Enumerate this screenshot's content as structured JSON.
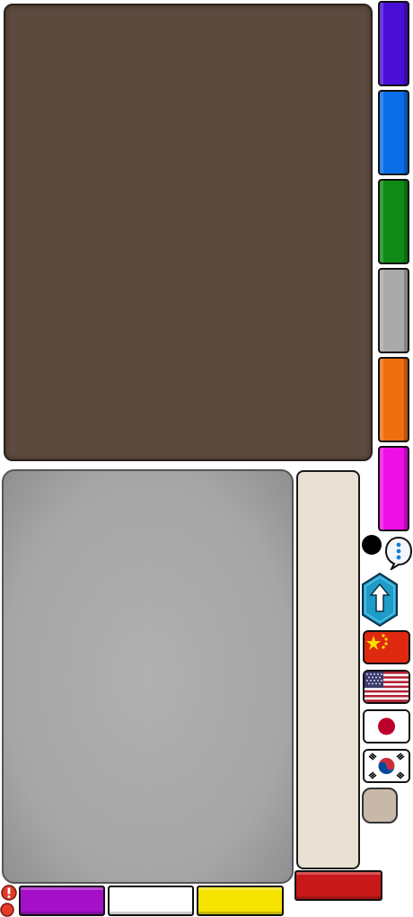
{
  "colors": {
    "board": "#5c4a3e",
    "panel": "#a8a8a8",
    "tray": "#e8e0d2",
    "swatches": [
      "#4a0fd6",
      "#0b6ee8",
      "#0f8a16",
      "#a9a9a9",
      "#ee6e10",
      "#ee0ee6"
    ],
    "bottom_buttons": [
      "#a50fc9",
      "#ffffff",
      "#f6e300"
    ],
    "red_button": "#c8181a",
    "hex_button": "#1f9cc8"
  },
  "swatches": [
    "purple",
    "blue",
    "green",
    "gray",
    "orange",
    "magenta"
  ],
  "bottom_buttons": [
    "purple",
    "white",
    "yellow"
  ],
  "flags": [
    "china-flag",
    "usa-flag",
    "japan-flag",
    "korea-flag"
  ],
  "icons": [
    "black-dot-icon",
    "chat-bubble-icon",
    "upload-arrow-icon",
    "alert-icon"
  ]
}
